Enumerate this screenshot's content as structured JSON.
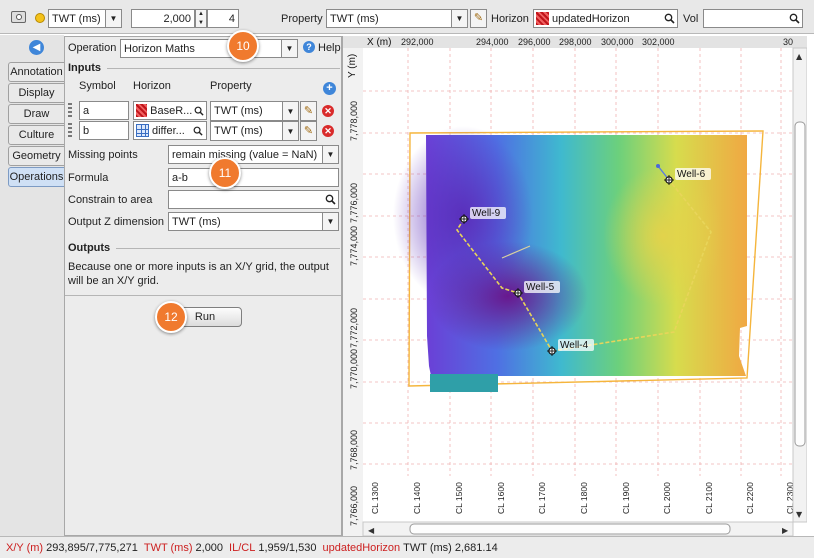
{
  "toolbar": {
    "domain_value": "TWT (ms)",
    "time_value": "2,000",
    "step_value": "4",
    "property_label": "Property",
    "property_value": "TWT (ms)",
    "horizon_label": "Horizon",
    "horizon_value": "updatedHorizon",
    "vol_label": "Vol",
    "vol_value": ""
  },
  "side_tabs": [
    "Annotation",
    "Display",
    "Draw",
    "Culture",
    "Geometry",
    "Operations"
  ],
  "panel": {
    "operation_label": "Operation",
    "operation_value": "Horizon Maths",
    "help_label": "Help",
    "inputs_title": "Inputs",
    "col_symbol": "Symbol",
    "col_horizon": "Horizon",
    "col_property": "Property",
    "rows": [
      {
        "symbol": "a",
        "horizon": "BaseR...",
        "property": "TWT (ms)"
      },
      {
        "symbol": "b",
        "horizon": "differ...",
        "property": "TWT (ms)"
      }
    ],
    "missing_label": "Missing points",
    "missing_value": "remain missing (value = NaN)",
    "formula_label": "Formula",
    "formula_value": "a-b",
    "constrain_label": "Constrain to area",
    "constrain_value": "",
    "outz_label": "Output Z dimension",
    "outz_value": "TWT (ms)",
    "outputs_title": "Outputs",
    "outputs_text_1": "Because one or more inputs is an X/Y grid, the output",
    "outputs_text_2": "will be an X/Y grid.",
    "run_label": "Run"
  },
  "badges": [
    "10",
    "11",
    "12"
  ],
  "map": {
    "x_axis_title": "X (m)",
    "y_axis_title": "Y (m)",
    "x_ticks": [
      "292,000",
      "294,000",
      "296,000",
      "298,000",
      "300,000",
      "302,000",
      "30"
    ],
    "y_ticks": [
      "7,778,000",
      "7,776,000",
      "7,774,000",
      "7,772,000",
      "7,770,000",
      "7,768,000",
      "7,766,000"
    ],
    "cl_ticks": [
      "CL 1300",
      "CL 1400",
      "CL 1500",
      "CL 1600",
      "CL 1700",
      "CL 1800",
      "CL 1900",
      "CL 2000",
      "CL 2100",
      "CL 2200",
      "CL 2300"
    ],
    "wells": [
      {
        "name": "Well-6"
      },
      {
        "name": "Well-9"
      },
      {
        "name": "Well-5"
      },
      {
        "name": "Well-4"
      }
    ]
  },
  "status": {
    "xy_label": "X/Y (m)",
    "xy_value": "293,895/7,775,271",
    "twt_label": "TWT (ms)",
    "twt_value": "2,000",
    "ilcl_label": "IL/CL",
    "ilcl_value": "1,959/1,530",
    "hz_label": "updatedHorizon",
    "hz_value": "TWT (ms) 2,681.14"
  }
}
